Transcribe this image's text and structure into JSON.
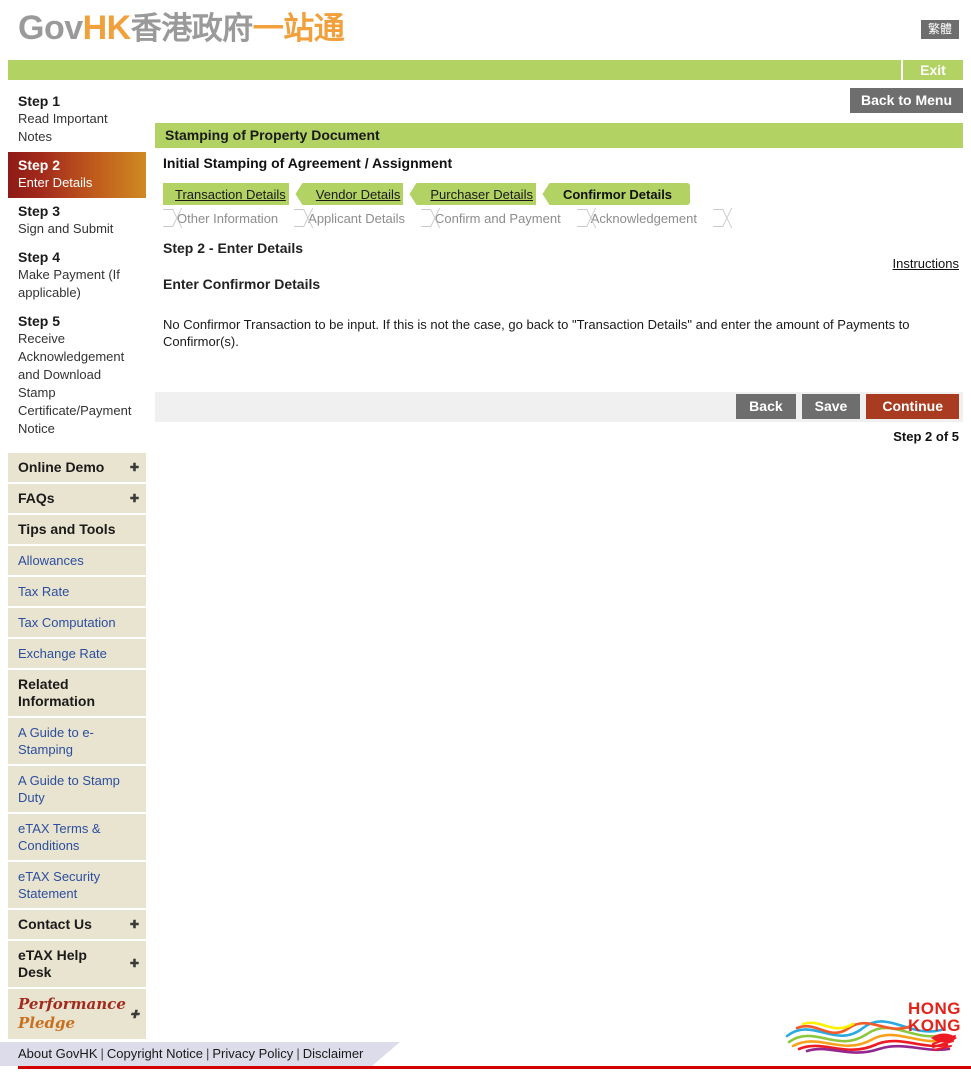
{
  "header": {
    "logo_gov": "Gov",
    "logo_hk": "HK",
    "logo_cn_grey": "香港政府",
    "logo_cn_orange": "一站通",
    "lang_toggle": "繁體",
    "exit_label": "Exit"
  },
  "sidebar": {
    "steps": [
      {
        "title": "Step 1",
        "desc": "Read Important Notes",
        "active": false
      },
      {
        "title": "Step 2",
        "desc": "Enter Details",
        "active": true
      },
      {
        "title": "Step 3",
        "desc": "Sign and Submit",
        "active": false
      },
      {
        "title": "Step 4",
        "desc": "Make Payment (If applicable)",
        "active": false
      },
      {
        "title": "Step 5",
        "desc": "Receive Acknowledgement and Download Stamp Certificate/Payment Notice",
        "active": false
      }
    ],
    "menu": [
      {
        "label": "Online Demo",
        "type": "head",
        "expand": true
      },
      {
        "label": "FAQs",
        "type": "head",
        "expand": true
      },
      {
        "label": "Tips and Tools",
        "type": "head",
        "expand": false
      },
      {
        "label": "Allowances",
        "type": "link",
        "expand": false
      },
      {
        "label": "Tax Rate",
        "type": "link",
        "expand": false
      },
      {
        "label": "Tax Computation",
        "type": "link",
        "expand": false
      },
      {
        "label": "Exchange Rate",
        "type": "link",
        "expand": false
      },
      {
        "label": "Related Information",
        "type": "head",
        "expand": false
      },
      {
        "label": "A Guide to e-Stamping",
        "type": "link",
        "expand": false
      },
      {
        "label": "A Guide to Stamp Duty",
        "type": "link",
        "expand": false
      },
      {
        "label": "eTAX Terms & Conditions",
        "type": "link",
        "expand": false
      },
      {
        "label": "eTAX Security Statement",
        "type": "link",
        "expand": false
      },
      {
        "label": "Contact Us",
        "type": "head",
        "expand": true
      },
      {
        "label": "eTAX Help Desk",
        "type": "head",
        "expand": true
      }
    ],
    "pledge_line1": "Performance",
    "pledge_line2": "Pledge"
  },
  "main": {
    "back_to_menu": "Back to Menu",
    "section_title": "Stamping of Property Document",
    "subtitle": "Initial Stamping of Agreement / Assignment",
    "tabs_row1": [
      {
        "label": "Transaction Details",
        "current": false
      },
      {
        "label": "Vendor Details",
        "current": false
      },
      {
        "label": "Purchaser Details",
        "current": false
      },
      {
        "label": "Confirmor Details",
        "current": true
      }
    ],
    "tabs_row2": [
      {
        "label": "Other Information"
      },
      {
        "label": "Applicant Details"
      },
      {
        "label": "Confirm and Payment"
      },
      {
        "label": "Acknowledgement"
      }
    ],
    "step_heading": "Step 2 - Enter Details",
    "instructions_label": "Instructions",
    "enter_heading": "Enter Confirmor Details",
    "body_text": "No Confirmor Transaction to be input. If this is not the case, go back to \"Transaction Details\" and enter the amount of Payments to Confirmor(s).",
    "buttons": {
      "back": "Back",
      "save": "Save",
      "continue": "Continue"
    },
    "step_count": "Step 2 of 5"
  },
  "footer": {
    "links": [
      "About GovHK",
      "Copyright Notice",
      "Privacy Policy",
      "Disclaimer"
    ],
    "separator": "|",
    "hk_logo_line1": "HONG",
    "hk_logo_line2": "KONG"
  },
  "colors": {
    "green": "#b2d264",
    "grey_button": "#6e6e6e",
    "primary_button": "#a93c20",
    "sidebar_beige": "#e9e4cf",
    "link_blue": "#2b4ea0",
    "footer_red": "#d40000"
  }
}
